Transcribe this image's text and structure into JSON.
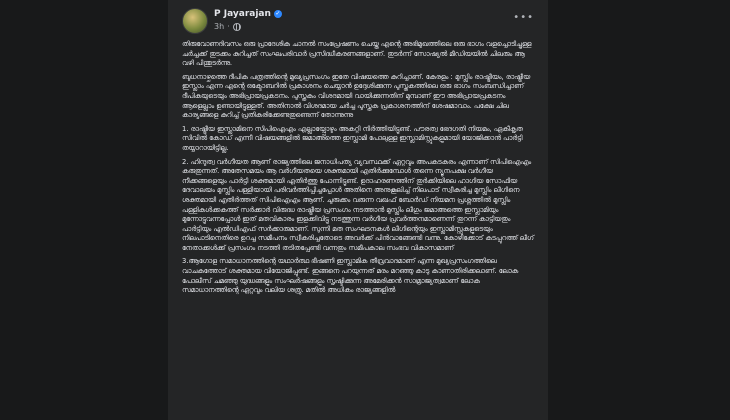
{
  "post": {
    "author": "P Jayarajan",
    "time": "3h",
    "dot": "·",
    "more_icon": "ellipsis-icon",
    "verified_icon": "verified-badge-icon",
    "audience_icon": "globe-icon",
    "paragraphs": [
      "തിരുവോണദിവസം ഒരു പ്രാദേശിക ചാനൽ സംപ്രേഷണം ചെയ്ത എന്റെ അഭിമുഖത്തിലെ ഒരു ഭാഗം വളച്ചൊടിച്ചുള്ള ചർച്ചക്ക് തുടക്കം കുറിച്ചത് സംഘപരിവാർ പ്രസിദ്ധീകരണങ്ങളാണ്. തുടർന്ന് സോഷ്യൽ മീഡിയയിൽ ചിലരും ആ വഴി പിന്തുടർന്നു.",
      "ബുധനാഴ്ചത്തെ ദീപിക പത്രത്തിന്റെ മുഖ്യപ്രസംഗം ഇതേ വിഷയത്തെ കുറിച്ചാണ്. കേരളം : മുസ്ലിം രാഷ്ട്രീയം, രാഷ്ട്രീയ ഇസ്ലാം എന്ന എന്റെ ഒക്ടോബറിൽ പ്രകാശനം ചെയ്യാൻ ഉദ്ദേശിക്കുന്ന പുസ്തകത്തിലെ ഒരു ഭാഗം സംബന്ധിച്ചാണ് ദീപികയുടെയും അഭിപ്രായപ്രകടനം. പുസ്തകം വിശദമായി വായിക്കുന്നതിന് മുമ്പാണ് ഈ അഭിപ്രായപ്രകടനം ആളെല്ലാം ഉണ്ടായിട്ടുള്ളത്. അതിനാൽ വിശദമായ ചർച്ച പുസ്തക പ്രകാശനത്തിന് ശേഷമാവാം. പക്ഷേ ചില കാര്യങ്ങളെ കുറിച്ച് പ്രതികരിക്കേണ്ടതുണ്ടെന്ന് തോന്നുന്നു",
      "1. രാഷ്ട്രീയ ഇസ്ലാമിനെ സിപിഐഎം എല്ലായ്പ്പോഴും അകറ്റി നിർത്തിയിട്ടുണ്ട്. പൗരത്വ ഭേദഗതി നിയമം, ഏകീകൃത സിവിൽ കോഡ് എന്നീ വിഷയങ്ങളിൽ ജമാഅത്തെ ഇസ്ലാമി പോലുള്ള ഇസ്ലാമിസ്റ്റുകളുമായി യോജിക്കാൻ പാർട്ടി തയ്യാറായിട്ടില്ല.",
      "2. ഹിന്ദുത്വ വർഗീയത ആണ് രാജ്യത്തിലെ ജനാധിപത്യ വ്യവസ്ഥക്ക് ഏറ്റവും അപകടകരം എന്നാണ് സിപിഐഎം കരുതുന്നത്. അതേസമയം ആ വർഗീയതയെ ശക്തമായി എതിർക്കുമ്പോൾ തന്നെ ന്യൂനപക്ഷ വർഗീയ നീക്കങ്ങളെയും പാർട്ടി ശക്തമായി എതിർത്തു പോന്നിട്ടുണ്ട്. ഉദാഹരണത്തിന് തുർക്കിയിലെ ഹാഗിയ സോഫിയ ദേവാലയം മുസ്ലിം പള്ളിയായി പരിവർത്തിപ്പിച്ചപ്പോൾ അതിനെ അനുകൂലിച്ച് നിലപാട് സ്വീകരിച്ച മുസ്ലിം ലീഗിനെ ശക്തമായി എതിർത്തത് സിപിഐഎം ആണ്. ചുരുക്കം വരുന്ന വഖഫ് ബോർഡ് നിയമന പ്രശ്നത്തിൽ മുസ്ലിം പള്ളികൾക്കകത്ത് സർക്കാർ വിരുദ്ധ രാഷ്ട്രീയ പ്രസംഗം നടത്താൻ മുസ്ലിം ലീഗും ജമാഅത്തെ ഇസ്ലാമിയും മുന്നോട്ടുവന്നപ്പോൾ ഇത് മതവികാരം ഇളക്കിവിട്ടു നടത്തുന്ന വർഗീയ പ്രവർത്തനമാണെന്ന് തുറന്ന് കാട്ടിയതും പാർട്ടിയും എൽഡിഎഫ് സർക്കാരുമാണ്. സുന്നി മത സംഘടനകൾ ലീഗിന്റെയും ഇസ്ലാമിസ്റ്റുകളുടെയും നിലപാടിനെതിരെ ഉറച്ച സമീപനം സ്വീകരിച്ചതോടെ അവർക്ക് പിൻവാങ്ങേണ്ടി വന്നു. കോഴിക്കോട് കടപ്പുറത്ത് ലീഗ് നേതാക്കൾക്ക് പ്രസംഗം നടത്തി തടിതപ്പേണ്ടി വന്നതും സമീപകാല സംഭവ വികാസമാണ്",
      "3.ആഗോള സമാധാനത്തിന്റെ യഥാർത്ഥ ഭീഷണി ഇസ്ലാമിക തീവ്രവാദമാണ് എന്ന മുഖ്യപ്രസംഗത്തിലെ വാചകത്തോട് ശക്തമായ വിയോജിപ്പുണ്ട്. ഇങ്ങനെ പറയുന്നത് മരം മറഞ്ഞു കാടു കാണാതിരിക്കലാണ്. ലോക പോലീസ് ചമഞ്ഞു യുദ്ധങ്ങളും സംഘർഷങ്ങളും സൃഷ്ടിക്കുന്ന അമേരിക്കൻ സാമ്രാജ്യത്വമാണ് ലോക സമാധാനത്തിന്റെ ഏറ്റവും വലിയ ശത്രു. മതിൽ അധികം രാജ്യങ്ങളിൽ"
    ]
  }
}
